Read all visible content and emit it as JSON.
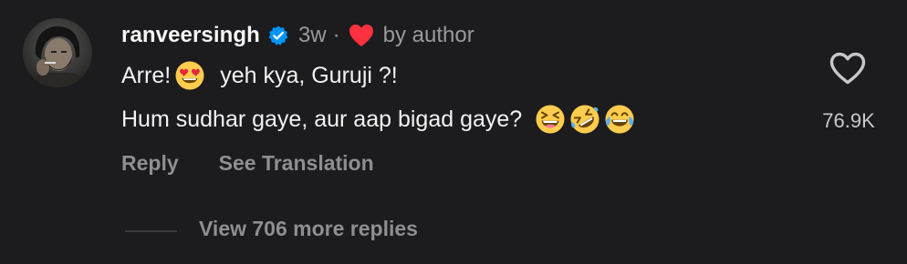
{
  "comment": {
    "username": "ranveersingh",
    "verified": true,
    "time_ago": "3w",
    "separator": "·",
    "liked_by_author_icon": "red-heart-icon",
    "liked_by_author_text": "by author",
    "line1_text_a": "Arre!",
    "line1_emoji": "heart-eyes-emoji",
    "line1_text_b": "yeh kya, Guruji ?!",
    "line2_text": "Hum sudhar gaye, aur aap bigad gaye?",
    "line2_emojis": [
      "laughing-emoji",
      "rolling-on-floor-laughing-emoji",
      "face-with-tears-of-joy-emoji"
    ],
    "like_icon": "heart-outline-icon",
    "like_count": "76.9K"
  },
  "actions": {
    "reply_label": "Reply",
    "see_translation_label": "See Translation"
  },
  "replies": {
    "view_more_label": "View 706 more replies"
  },
  "colors": {
    "background": "#1c1c1e",
    "primary_text": "#f2f2f2",
    "secondary_text": "#8e8e93",
    "verified_blue": "#0095f6",
    "heart_red": "#ff3040",
    "emoji_yellow": "#ffcc4d"
  }
}
